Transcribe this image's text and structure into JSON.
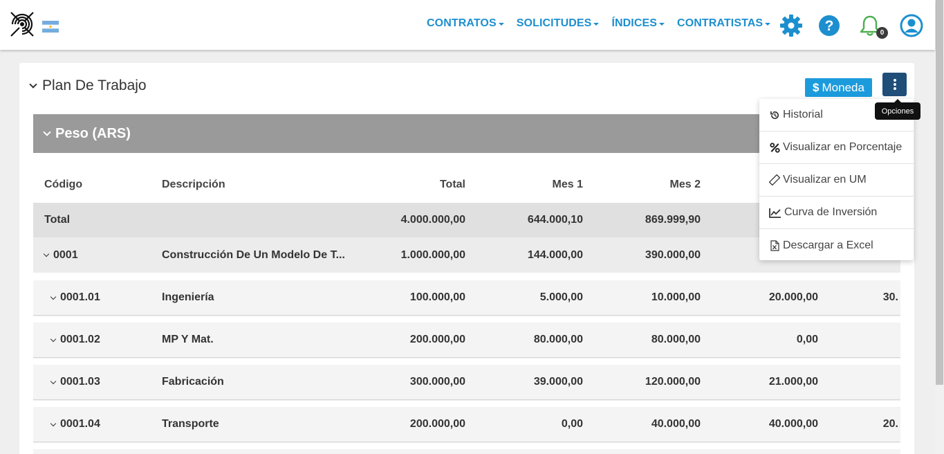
{
  "nav": {
    "menu": [
      {
        "label": "CONTRATOS"
      },
      {
        "label": "SOLICITUDES"
      },
      {
        "label": "ÍNDICES"
      },
      {
        "label": "CONTRATISTAS"
      }
    ],
    "notifications_count": "0",
    "icons": [
      "gear-icon",
      "help-icon",
      "bell-icon",
      "user-icon"
    ]
  },
  "card": {
    "title": "Plan De Trabajo",
    "moneda_label": "Moneda",
    "moneda_symbol": "$",
    "options_tooltip": "Opciones"
  },
  "section": {
    "title": "Peso (ARS)"
  },
  "options_menu": [
    {
      "label": "Historial",
      "icon": "history-icon"
    },
    {
      "label": "Visualizar en Porcentaje",
      "icon": "percent-icon"
    },
    {
      "label": "Visualizar en UM",
      "icon": "ruler-icon"
    },
    {
      "label": "Curva de Inversión",
      "icon": "line-chart-icon"
    },
    {
      "label": "Descargar a Excel",
      "icon": "excel-file-icon"
    }
  ],
  "table": {
    "headers": {
      "code": "Código",
      "desc": "Descripción",
      "total": "Total",
      "m1": "Mes 1",
      "m2": "Mes 2"
    },
    "total_row": {
      "code": "Total",
      "total": "4.000.000,00",
      "m1": "644.000,10",
      "m2": "869.999,90"
    },
    "group_row": {
      "code": "0001",
      "desc": "Construcción De Un Modelo De T...",
      "total": "1.000.000,00",
      "m1": "144.000,00",
      "m2": "390.000,00",
      "m3": ""
    },
    "rows": [
      {
        "code": "0001.01",
        "desc": "Ingeniería",
        "total": "100.000,00",
        "m1": "5.000,00",
        "m2": "10.000,00",
        "m3": "20.000,00",
        "m4": "30."
      },
      {
        "code": "0001.02",
        "desc": "MP Y Mat.",
        "total": "200.000,00",
        "m1": "80.000,00",
        "m2": "80.000,00",
        "m3": "0,00",
        "m4": ""
      },
      {
        "code": "0001.03",
        "desc": "Fabricación",
        "total": "300.000,00",
        "m1": "39.000,00",
        "m2": "120.000,00",
        "m3": "21.000,00",
        "m4": ""
      },
      {
        "code": "0001.04",
        "desc": "Transporte",
        "total": "200.000,00",
        "m1": "0,00",
        "m2": "40.000,00",
        "m3": "40.000,00",
        "m4": "20."
      }
    ]
  },
  "colors": {
    "nav_text": "#1d8fcf",
    "moneda_bg": "#1c9bdc",
    "options_bg": "#1f4e79",
    "section_bg": "#9a9a9a",
    "bell_green": "#4caf50"
  }
}
